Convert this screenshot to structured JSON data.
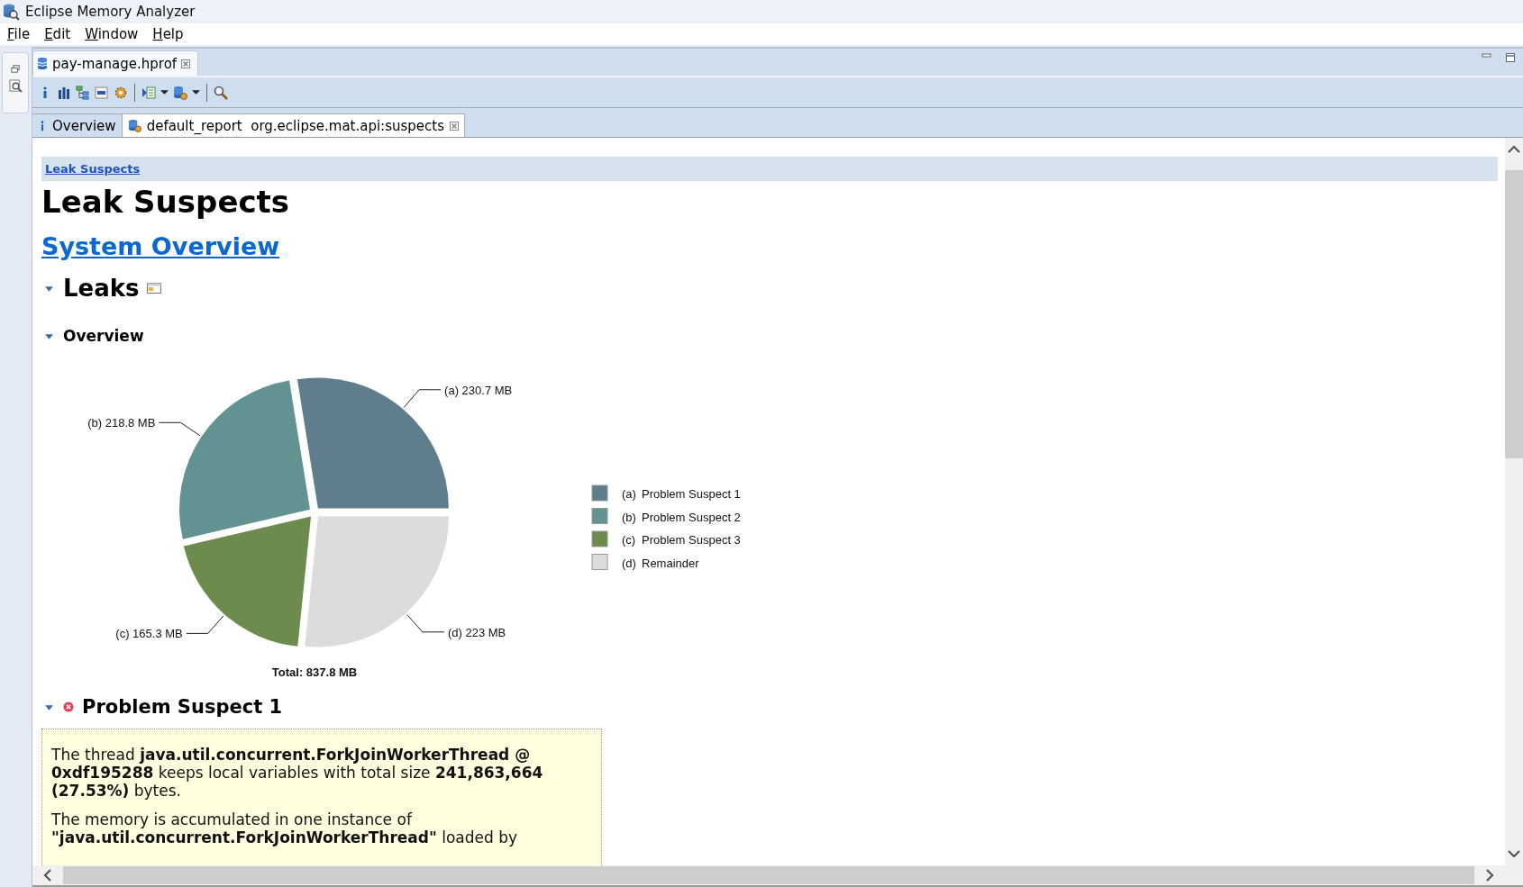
{
  "window": {
    "title": "Eclipse Memory Analyzer"
  },
  "menu": [
    {
      "label": "File"
    },
    {
      "label": "Edit"
    },
    {
      "label": "Window"
    },
    {
      "label": "Help"
    }
  ],
  "editor_tab": {
    "label": "pay-manage.hprof",
    "selected": true
  },
  "view_tabs": [
    {
      "label": "Overview",
      "selected": false,
      "closable": false
    },
    {
      "label": "default_report  org.eclipse.mat.api:suspects",
      "selected": true,
      "closable": true
    }
  ],
  "report": {
    "breadcrumb": "Leak Suspects",
    "title": "Leak Suspects",
    "link": "System Overview",
    "leaks": {
      "title": "Leaks",
      "expanded": true
    },
    "overview": {
      "title": "Overview",
      "expanded": true,
      "chart_data": {
        "type": "pie",
        "title": "Total: 837.8 MB",
        "categories": [
          "(a)",
          "(b)",
          "(c)",
          "(d)"
        ],
        "values": [
          230.7,
          218.8,
          165.3,
          223
        ],
        "value_labels": [
          "(a)  230.7 MB",
          "(b)  218.8 MB",
          "(c)  165.3 MB",
          "(d)  223 MB"
        ],
        "legend": [
          {
            "label": "Problem Suspect 1",
            "color": "#5f7d8c"
          },
          {
            "label": "Problem Suspect 2",
            "color": "#629292"
          },
          {
            "label": "Problem Suspect 3",
            "color": "#6d8b4c"
          },
          {
            "label": "Remainder",
            "color": "#dcdcdc"
          }
        ]
      }
    },
    "suspect": {
      "title": "Problem Suspect 1",
      "expanded": true,
      "paragraphs": [
        "The thread **java.util.concurrent.ForkJoinWorkerThread @ 0xdf195288** keeps local variables with total size **241,863,664 (27.53%)** bytes.",
        "The memory is accumulated in one instance of **\"java.util.concurrent.ForkJoinWorkerThread\"** loaded by"
      ]
    }
  }
}
